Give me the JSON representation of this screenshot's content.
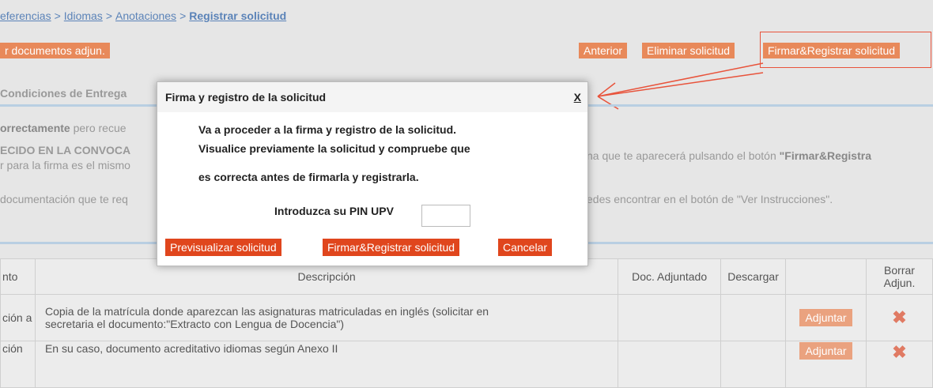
{
  "breadcrumb": {
    "item1": "eferencias",
    "sep1": ">",
    "item2": "Idiomas",
    "sep2": ">",
    "item3": "Anotaciones",
    "sep3": ">",
    "current": "Registrar solicitud"
  },
  "toolbar": {
    "left_btn": "r documentos adjun.",
    "anterior": "Anterior",
    "eliminar": "Eliminar solicitud",
    "firmar": "Firmar&Registrar solicitud"
  },
  "section": {
    "title": "Condiciones de Entrega"
  },
  "paras": {
    "p1_bold": "orrectamente",
    "p1_rest": " pero recue",
    "p2_left": "ECIDO EN LA CONVOCA",
    "p2_right_pre": "na que te aparecerá pulsando el botón ",
    "p2_right_bold": "\"Firmar&Registra",
    "p3_left": "r para la firma es el mismo",
    "p4_left": "documentación que te req",
    "p4_right": "edes encontrar en el botón de \"Ver Instrucciones\"."
  },
  "modal": {
    "title": "Firma y registro de la solicitud",
    "close": "X",
    "line1": "Va a proceder a la firma y registro de la solicitud.",
    "line2": "Visualice previamente la solicitud y compruebe que",
    "line3": "es correcta antes de firmarla y registrarla.",
    "pin_label": "Introduzca su PIN UPV",
    "pin_value": "",
    "btn_preview": "Previsualizar solicitud",
    "btn_sign": "Firmar&Registrar solicitud",
    "btn_cancel": "Cancelar"
  },
  "table": {
    "headers": [
      "nto",
      "Descripción",
      "Doc. Adjuntado",
      "Descargar",
      "",
      "Borrar Adjun."
    ],
    "rows": [
      {
        "c0": "ción a",
        "desc1": "Copia de la matrícula donde aparezcan las asignaturas matriculadas en inglés (solicitar en",
        "desc2": "secretaria el documento:\"Extracto con Lengua de Docencia\")",
        "btn": "Adjuntar"
      },
      {
        "c0": "ción",
        "desc1": "En su caso, documento acreditativo idiomas según Anexo II",
        "desc2": "",
        "btn": "Adjuntar"
      }
    ]
  },
  "colors": {
    "button": "#e8895a",
    "modal_button": "#e0461d",
    "highlight": "#e8533b",
    "link": "#5b83b8"
  }
}
